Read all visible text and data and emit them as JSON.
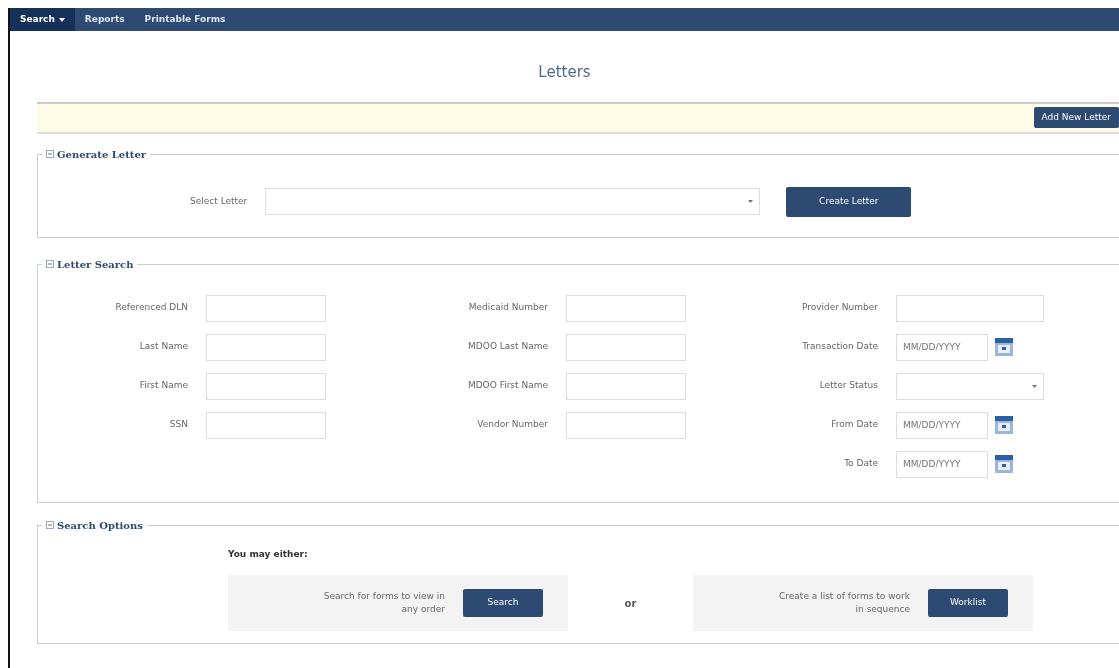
{
  "navbar": {
    "items": [
      {
        "label": "Search",
        "dropdown": true,
        "selected": true
      },
      {
        "label": "Reports",
        "dropdown": false,
        "selected": false
      },
      {
        "label": "Printable Forms",
        "dropdown": false,
        "selected": false
      }
    ]
  },
  "page_title": "Letters",
  "toolbar": {
    "button": "Add New Letter"
  },
  "generate_letter": {
    "legend": "Generate Letter",
    "label": "Select Letter",
    "button": "Create Letter"
  },
  "letter_search": {
    "legend": "Letter Search",
    "columns": [
      [
        {
          "label": "Referenced DLN",
          "kind": "text"
        },
        {
          "label": "Last Name",
          "kind": "text"
        },
        {
          "label": "First Name",
          "kind": "text"
        },
        {
          "label": "SSN",
          "kind": "text"
        }
      ],
      [
        {
          "label": "Medicaid Number",
          "kind": "text"
        },
        {
          "label": "MDOO Last Name",
          "kind": "text"
        },
        {
          "label": "MDOO First Name",
          "kind": "text"
        },
        {
          "label": "Vendor Number",
          "kind": "text"
        }
      ],
      [
        {
          "label": "Provider Number",
          "kind": "text"
        },
        {
          "label": "Transaction Date",
          "kind": "date",
          "placeholder": "MM/DD/YYYY"
        },
        {
          "label": "Letter Status",
          "kind": "select"
        },
        {
          "label": "From Date",
          "kind": "date",
          "placeholder": "MM/DD/YYYY"
        },
        {
          "label": "To Date",
          "kind": "date",
          "placeholder": "MM/DD/YYYY"
        }
      ]
    ]
  },
  "search_options": {
    "legend": "Search Options",
    "intro": "You may either:",
    "separator": "or",
    "options": [
      {
        "text": "Search for forms to view in any order",
        "button": "Search"
      },
      {
        "text": "Create a list of forms to work in sequence",
        "button": "Worklist"
      }
    ]
  }
}
